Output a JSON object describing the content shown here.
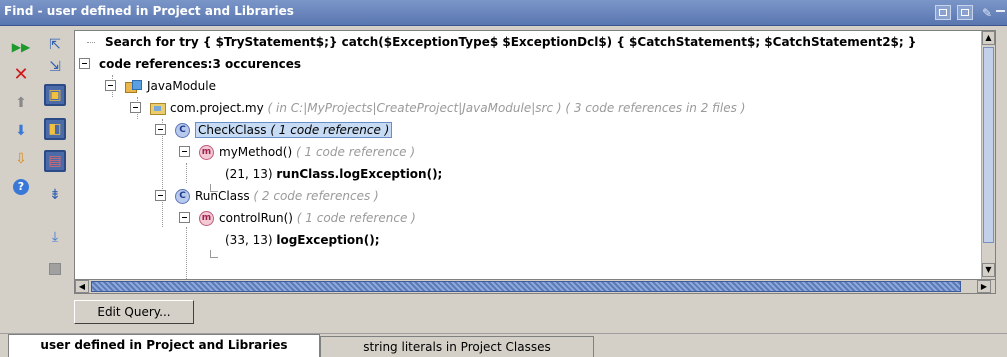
{
  "window": {
    "title": "Find - user defined in Project and Libraries"
  },
  "toolbar_icons": [
    "rerun-icon",
    "expand-all-icon",
    "close-icon",
    "collapse-all-icon",
    "previous-icon",
    "group-by-module-icon",
    "next-icon",
    "group-by-package-icon",
    "export-icon",
    "merge-icon",
    "help-icon",
    "autoscroll-icon",
    "import-icon",
    "stop-icon"
  ],
  "tree": {
    "search_label": "Search for try {  $TryStatement$;} catch($ExceptionType$ $ExceptionDcl$) {      $CatchStatement$; $CatchStatement2$; }",
    "code_refs_label": "code references:3 occurences",
    "module": "JavaModule",
    "package": {
      "name": "com.project.my",
      "hint": "( in C:|MyProjects|CreateProject|JavaModule|src ) ( 3 code references in 2 files )"
    },
    "check_class": {
      "name": "CheckClass",
      "hint": "( 1 code reference )"
    },
    "my_method": {
      "name": "myMethod()",
      "hint": "( 1 code reference )"
    },
    "ref1": {
      "pos": "(21, 13) ",
      "code": "runClass.logException();"
    },
    "run_class": {
      "name": "RunClass",
      "hint": "( 2 code references )"
    },
    "control_run": {
      "name": "controlRun()",
      "hint": "( 1 code reference )"
    },
    "ref2": {
      "pos": "(33, 13) ",
      "code": "logException();"
    }
  },
  "buttons": {
    "edit_query": "Edit Query..."
  },
  "tabs": [
    {
      "label": "user defined in Project and Libraries",
      "active": true
    },
    {
      "label": "string literals in Project Classes",
      "active": false
    }
  ],
  "colors": {
    "title_bar": "#5a76b0",
    "selection": "#c7dcf4",
    "hint_text": "#9a9a9a"
  }
}
